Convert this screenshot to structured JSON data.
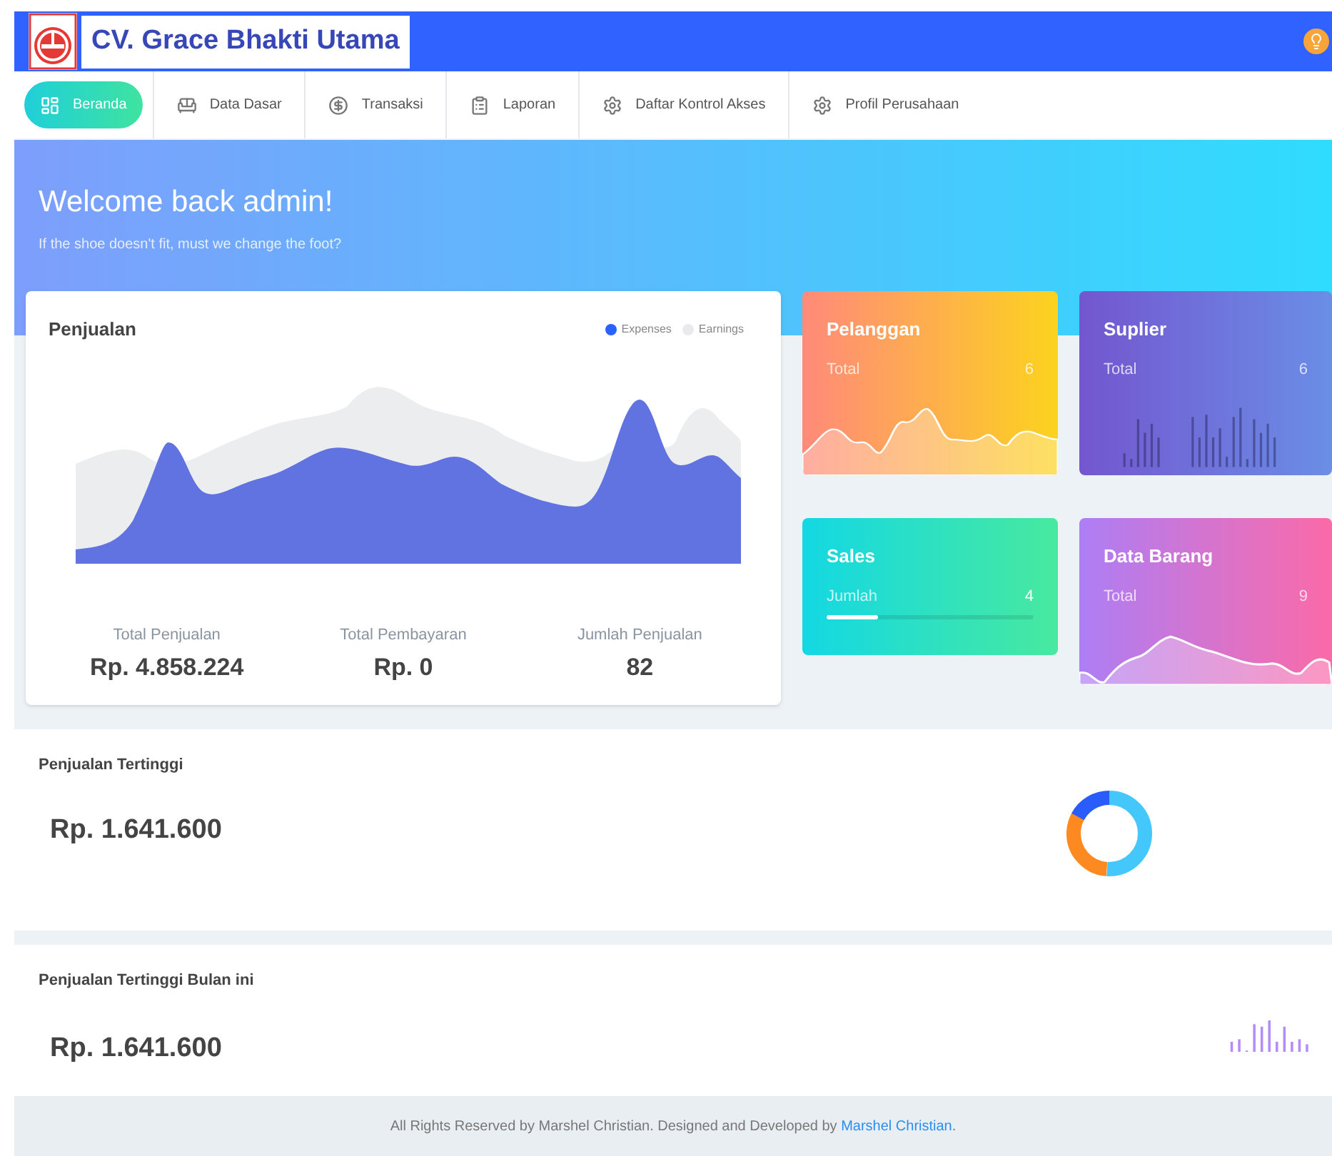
{
  "header": {
    "company": "CV. Grace Bhakti Utama"
  },
  "nav": [
    {
      "label": "Beranda",
      "selected": true
    },
    {
      "label": "Data Dasar",
      "selected": false
    },
    {
      "label": "Transaksi",
      "selected": false
    },
    {
      "label": "Laporan",
      "selected": false
    },
    {
      "label": "Daftar Kontrol Akses",
      "selected": false
    },
    {
      "label": "Profil Perusahaan",
      "selected": false
    }
  ],
  "hero": {
    "title": "Welcome back admin!",
    "subtitle": "If the shoe doesn't fit, must we change the foot?"
  },
  "sales_card": {
    "title": "Penjualan",
    "legend": [
      {
        "label": "Expenses",
        "color": "#2962ff"
      },
      {
        "label": "Earnings",
        "color": "#e8eaee"
      }
    ],
    "stats": [
      {
        "label": "Total Penjualan",
        "value": "Rp. 4.858.224"
      },
      {
        "label": "Total Pembayaran",
        "value": "Rp. 0"
      },
      {
        "label": "Jumlah Penjualan",
        "value": "82"
      }
    ]
  },
  "stat_cards": [
    {
      "kind": "wave",
      "title": "Pelanggan",
      "label": "Total",
      "value": "6"
    },
    {
      "kind": "bars",
      "title": "Suplier",
      "label": "Total",
      "value": "6"
    },
    {
      "kind": "progress",
      "title": "Sales",
      "label": "Jumlah",
      "value": "4",
      "level": 0.25
    },
    {
      "kind": "wave",
      "title": "Data Barang",
      "label": "Total",
      "value": "9"
    }
  ],
  "highlights": [
    {
      "kind": "donut",
      "title": "Penjualan Tertinggi",
      "value": "Rp. 1.641.600"
    },
    {
      "kind": "bars",
      "title": "Penjualan Tertinggi Bulan ini",
      "value": "Rp. 1.641.600"
    }
  ],
  "footer": {
    "text": "All Rights Reserved by Marshel Christian. Designed and Developed by",
    "link": "Marshel Christian",
    "end": "."
  }
}
